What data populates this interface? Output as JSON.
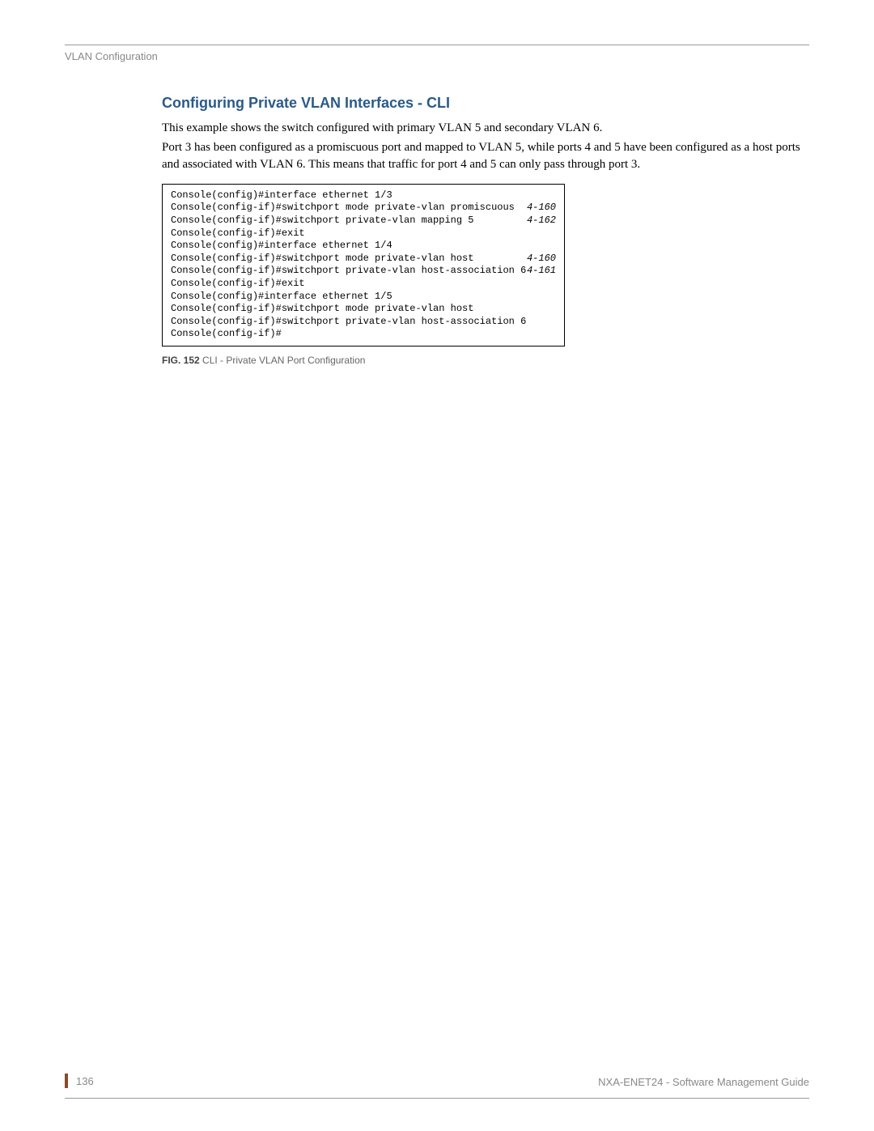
{
  "header": {
    "section": "VLAN Configuration"
  },
  "content": {
    "heading": "Configuring Private VLAN Interfaces - CLI",
    "para1": "This example shows the switch configured with primary VLAN 5 and secondary VLAN 6.",
    "para2": "Port 3 has been configured as a promiscuous port and mapped to VLAN 5, while ports 4 and 5 have been configured as a host ports and associated with VLAN 6. This means that traffic for port 4 and 5 can only pass through port 3."
  },
  "cli": {
    "lines": [
      {
        "cmd": "Console(config)#interface ethernet 1/3",
        "ref": ""
      },
      {
        "cmd": "Console(config-if)#switchport mode private-vlan promiscuous",
        "ref": "4-160"
      },
      {
        "cmd": "Console(config-if)#switchport private-vlan mapping 5",
        "ref": "4-162"
      },
      {
        "cmd": "Console(config-if)#exit",
        "ref": ""
      },
      {
        "cmd": "Console(config)#interface ethernet 1/4",
        "ref": ""
      },
      {
        "cmd": "Console(config-if)#switchport mode private-vlan host",
        "ref": "4-160"
      },
      {
        "cmd": "Console(config-if)#switchport private-vlan host-association 6",
        "ref": "4-161"
      },
      {
        "cmd": "Console(config-if)#exit",
        "ref": ""
      },
      {
        "cmd": "Console(config)#interface ethernet 1/5",
        "ref": ""
      },
      {
        "cmd": "Console(config-if)#switchport mode private-vlan host",
        "ref": ""
      },
      {
        "cmd": "Console(config-if)#switchport private-vlan host-association 6",
        "ref": ""
      },
      {
        "cmd": "Console(config-if)#",
        "ref": ""
      }
    ]
  },
  "figure": {
    "label": "FIG. 152",
    "caption": "  CLI - Private VLAN Port Configuration"
  },
  "footer": {
    "page": "136",
    "doc": "NXA-ENET24 - Software Management Guide"
  }
}
